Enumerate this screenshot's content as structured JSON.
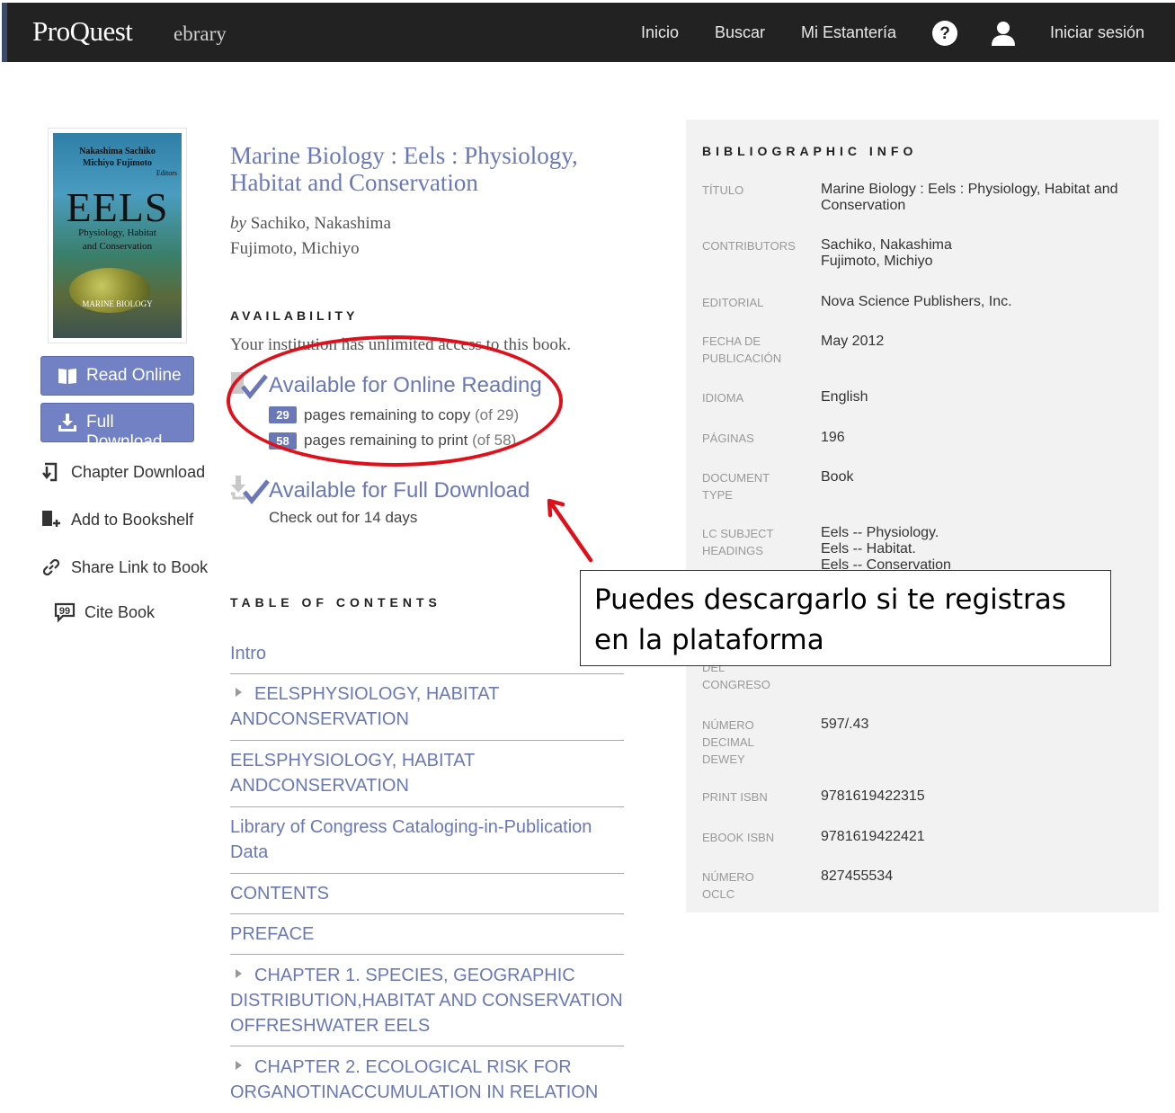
{
  "app": {
    "brand": "ProQuest",
    "product": "ebrary"
  },
  "nav": {
    "home": "Inicio",
    "search": "Buscar",
    "shelf": "Mi Estantería",
    "login": "Iniciar sesión",
    "help_icon": "help-icon",
    "user_icon": "user-icon"
  },
  "cover": {
    "authors_line1": "Nakashima Sachiko",
    "authors_line2": "Michiyo Fujimoto",
    "editors": "Editors",
    "title": "EELS",
    "subtitle_line1": "Physiology, Habitat",
    "subtitle_line2": "and Conservation",
    "series": "MARINE BIOLOGY"
  },
  "actions": {
    "read_online": "Read Online",
    "full_download": "Full Download",
    "chapter_download": "Chapter Download",
    "add_to_bookshelf": "Add to Bookshelf",
    "share_link": "Share Link to Book",
    "cite_book": "Cite Book"
  },
  "book": {
    "title": "Marine Biology : Eels : Physiology, Habitat and Conservation",
    "by": "by",
    "author1": "Sachiko, Nakashima",
    "author2": "Fujimoto, Michiyo"
  },
  "availability": {
    "heading": "AVAILABILITY",
    "access_text": "Your institution has unlimited access to this book.",
    "online_reading": "Available for Online Reading",
    "copy_count": "29",
    "copy_text": "pages remaining to copy",
    "copy_total": "(of 29)",
    "print_count": "58",
    "print_text": "pages remaining to print",
    "print_total": "(of 58)",
    "full_download": "Available for Full Download",
    "checkout": "Check out for 14 days"
  },
  "toc": {
    "heading": "TABLE OF CONTENTS",
    "items": [
      {
        "label": "Intro"
      },
      {
        "label": "EELSPHYSIOLOGY, HABITAT ANDCONSERVATION"
      },
      {
        "label": "EELSPHYSIOLOGY, HABITAT ANDCONSERVATION"
      },
      {
        "label": "Library of Congress Cataloging-in-Publication Data"
      },
      {
        "label": "CONTENTS"
      },
      {
        "label": "PREFACE"
      },
      {
        "label": "CHAPTER 1. SPECIES, GEOGRAPHIC DISTRIBUTION,HABITAT AND CONSERVATION OFFRESHWATER EELS"
      },
      {
        "label": "CHAPTER 2. ECOLOGICAL RISK FOR ORGANOTINACCUMULATION IN RELATION"
      }
    ]
  },
  "biblio": {
    "heading": "BIBLIOGRAPHIC INFO",
    "rows": [
      {
        "label": "Título",
        "value": "Marine Biology : Eels : Physiology, Habitat and Conservation"
      },
      {
        "label": "Contributors",
        "value": "Sachiko, Nakashima\nFujimoto, Michiyo"
      },
      {
        "label": "Editorial",
        "value": "Nova Science Publishers, Inc."
      },
      {
        "label": "Fecha de publicación",
        "value": "May 2012"
      },
      {
        "label": "Idioma",
        "value": "English"
      },
      {
        "label": "Páginas",
        "value": "196"
      },
      {
        "label": "Document type",
        "value": "Book"
      },
      {
        "label": "LC subject headings",
        "value": "Eels -- Physiology.\nEels -- Habitat.\nEels -- Conservation"
      },
      {
        "label": "del congreso",
        "value": ""
      },
      {
        "label": "Número decimal Dewey",
        "value": "597/.43"
      },
      {
        "label": "Print ISBN",
        "value": "9781619422315"
      },
      {
        "label": "eBook ISBN",
        "value": "9781619422421"
      },
      {
        "label": "Número OCLC",
        "value": "827455534"
      }
    ]
  },
  "annotation": {
    "text": "Puedes descargarlo si te registras en la plataforma",
    "color": "#e0101a"
  },
  "colors": {
    "accent": "#6a78b8",
    "button": "#7181c4",
    "topbar": "#222222"
  }
}
